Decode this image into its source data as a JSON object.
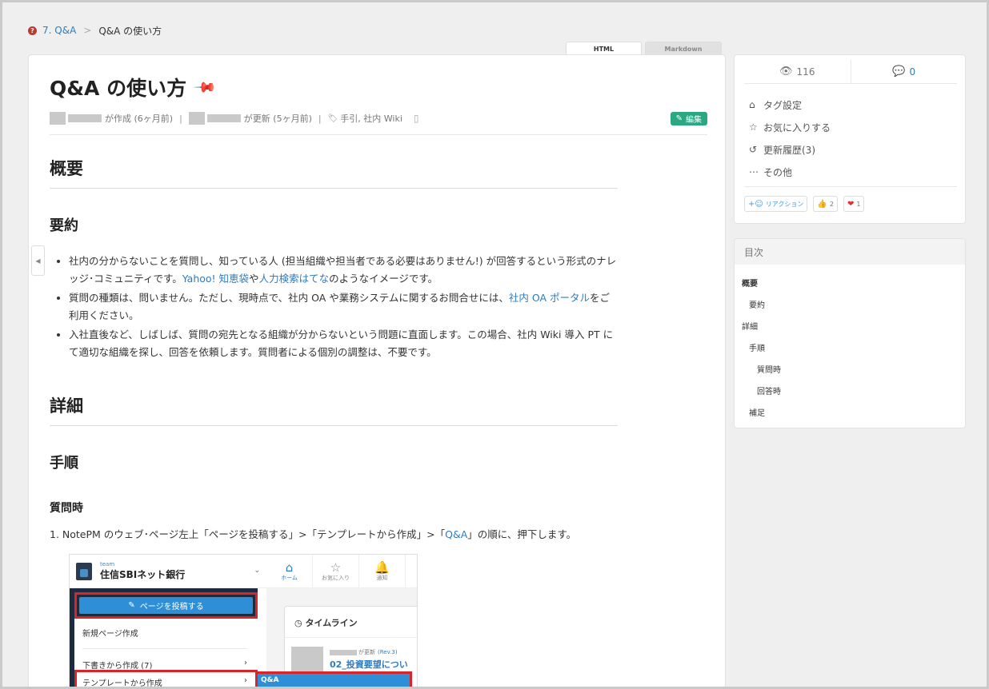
{
  "breadcrumb": {
    "parent": "7. Q&A",
    "current": "Q&A の使い方"
  },
  "view_tabs": [
    "HTML",
    "Markdown"
  ],
  "page": {
    "title": "Q&A の使い方",
    "meta": {
      "created": "が作成 (6ヶ月前)",
      "updated": "が更新 (5ヶ月前)",
      "tags": "手引, 社内 Wiki",
      "edit_label": "編集"
    }
  },
  "content": {
    "h_overview": "概要",
    "h_summary": "要約",
    "bullet1": "社内の分からないことを質問し、知っている人 (担当組織や担当者である必要はありません!) が回答するという形式のナレッジ･コミュニティです。",
    "bullet1_link1": "Yahoo! 知恵袋",
    "bullet1_mid": "や",
    "bullet1_link2": "人力検索はてな",
    "bullet1_end": "のようなイメージです。",
    "bullet2": "質問の種類は、問いません。ただし、現時点で、社内 OA や業務システムに関するお問合せには、",
    "bullet2_link": "社内 OA ポータル",
    "bullet2_end": "をご利用ください。",
    "bullet3": "入社直後など、しばしば、質問の宛先となる組織が分からないという問題に直面します。この場合、社内 Wiki 導入 PT にて適切な組織を探し、回答を依頼します。質問者による個別の調整は、不要です。",
    "h_detail": "詳細",
    "h_procedure": "手順",
    "h_when_asking": "質問時",
    "step1_prefix": "1. NotePM のウェブ･ページ左上「ページを投稿する」>「テンプレートから作成」>「",
    "step1_link": "Q&A",
    "step1_suffix": "」の順に、押下します。"
  },
  "screenshot": {
    "team_label": "team",
    "team_name": "住信SBIネット銀行",
    "nav": [
      "ホーム",
      "お気に入り",
      "通知"
    ],
    "post_button": "ページを投稿する",
    "menu": [
      "新規ページ作成",
      "下書きから作成 (7)",
      "テンプレートから作成"
    ],
    "qa_label": "Q&A",
    "timeline_title": "タイムライン",
    "tl_meta": "が更新",
    "tl_rev": "(Rev.3)",
    "tl_title": "02_投資要望につい"
  },
  "sidebar": {
    "views": "116",
    "comments": "0",
    "actions": [
      "タグ設定",
      "お気に入りする",
      "更新履歴(3)",
      "その他"
    ],
    "reaction_add": "リアクション",
    "reaction_like": "2",
    "reaction_heart": "1"
  },
  "toc": {
    "title": "目次",
    "items": [
      "概要",
      "要約",
      "詳細",
      "手順",
      "質問時",
      "回答時",
      "補足"
    ]
  },
  "colors": {
    "accent": "#2f7cc0",
    "edit": "#2aa882",
    "highlight": "#d9252a"
  }
}
